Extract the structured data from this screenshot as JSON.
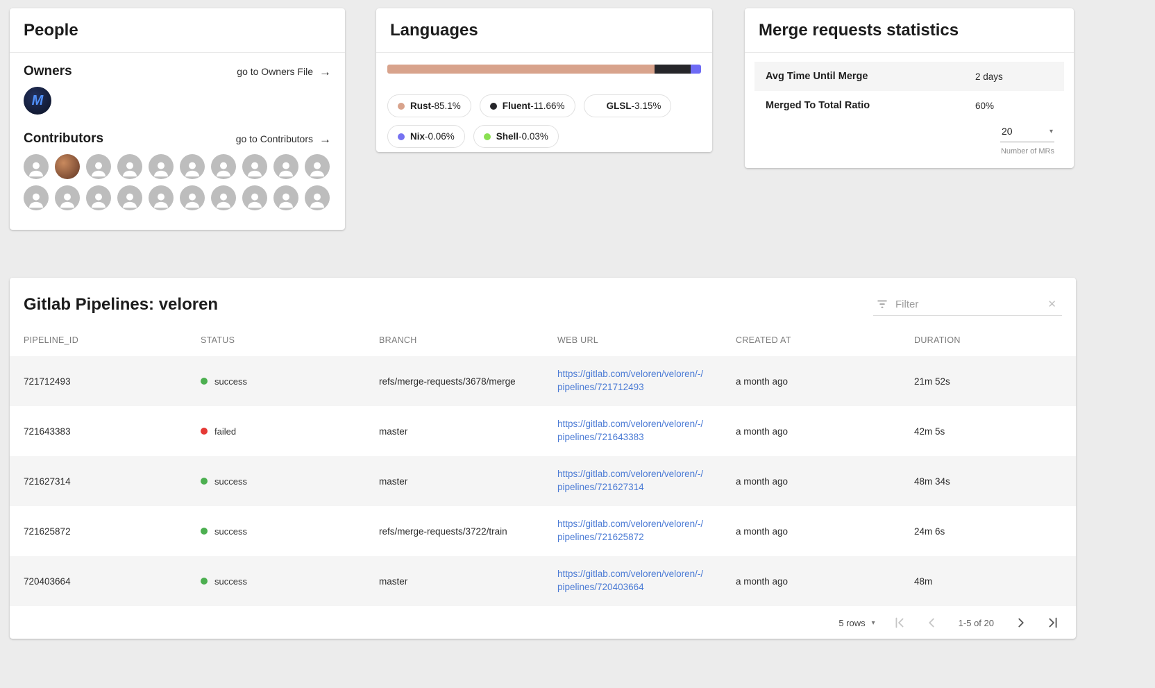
{
  "icons": {
    "arrow_right": "→",
    "caret_down": "▾",
    "clear": "✕",
    "owner_logo_letter": "M"
  },
  "people": {
    "title": "People",
    "owners_title": "Owners",
    "owners_link": "go to Owners File",
    "contributors_title": "Contributors",
    "contributors_link": "go to Contributors"
  },
  "languages": {
    "title": "Languages",
    "sep": " - ",
    "bar": [
      {
        "name": "Rust",
        "pct": 85.1,
        "color": "#d8a38c"
      },
      {
        "name": "Fluent",
        "pct": 11.66,
        "color": "#26262a"
      },
      {
        "name": "GLSL",
        "pct": 3.24,
        "color": "#6e6bf5"
      }
    ],
    "chips": [
      {
        "name": "Rust",
        "value": "85.1%",
        "color": "#d8a38c"
      },
      {
        "name": "Fluent",
        "value": "11.66%",
        "color": "#26262a"
      },
      {
        "name": "GLSL",
        "value": "3.15%",
        "color": "#ffffff"
      },
      {
        "name": "Nix",
        "value": "0.06%",
        "color": "#7672f1"
      },
      {
        "name": "Shell",
        "value": "0.03%",
        "color": "#89e051"
      }
    ]
  },
  "merge_stats": {
    "title": "Merge requests statistics",
    "rows": [
      {
        "label": "Avg Time Until Merge",
        "value": "2 days"
      },
      {
        "label": "Merged To Total Ratio",
        "value": "60%"
      }
    ],
    "mr_count": "20",
    "mr_count_label": "Number of MRs"
  },
  "pipelines": {
    "title": "Gitlab Pipelines: veloren",
    "filter_placeholder": "Filter",
    "columns": [
      "PIPELINE_ID",
      "STATUS",
      "BRANCH",
      "WEB URL",
      "CREATED AT",
      "DURATION"
    ],
    "rows": [
      {
        "pipeline_id": "721712493",
        "status": "success",
        "dot": "#4caf50",
        "branch": "refs/merge-requests/3678/merge",
        "web_url": "https://gitlab.com/veloren/veloren/-/pipelines/721712493",
        "created_at": "a month ago",
        "duration": "21m 52s"
      },
      {
        "pipeline_id": "721643383",
        "status": "failed",
        "dot": "#e53935",
        "branch": "master",
        "web_url": "https://gitlab.com/veloren/veloren/-/pipelines/721643383",
        "created_at": "a month ago",
        "duration": "42m 5s"
      },
      {
        "pipeline_id": "721627314",
        "status": "success",
        "dot": "#4caf50",
        "branch": "master",
        "web_url": "https://gitlab.com/veloren/veloren/-/pipelines/721627314",
        "created_at": "a month ago",
        "duration": "48m 34s"
      },
      {
        "pipeline_id": "721625872",
        "status": "success",
        "dot": "#4caf50",
        "branch": "refs/merge-requests/3722/train",
        "web_url": "https://gitlab.com/veloren/veloren/-/pipelines/721625872",
        "created_at": "a month ago",
        "duration": "24m 6s"
      },
      {
        "pipeline_id": "720403664",
        "status": "success",
        "dot": "#4caf50",
        "branch": "master",
        "web_url": "https://gitlab.com/veloren/veloren/-/pipelines/720403664",
        "created_at": "a month ago",
        "duration": "48m"
      }
    ],
    "footer": {
      "rows_per_page": "5 rows",
      "range_label": "1-5 of 20"
    }
  }
}
